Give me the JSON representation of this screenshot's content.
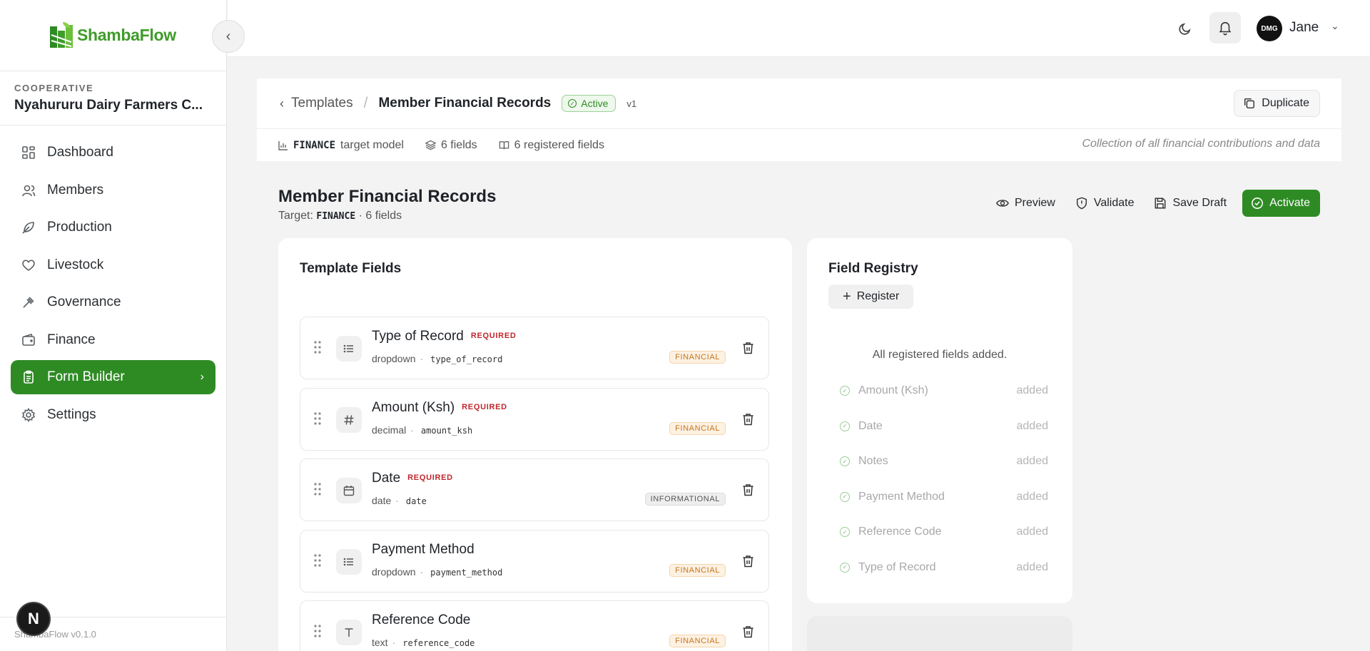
{
  "brand": {
    "name": "ShambaFlow",
    "version": "ShambaFlow v0.1.0"
  },
  "cooperative": {
    "label": "COOPERATIVE",
    "name": "Nyahururu Dairy Farmers C..."
  },
  "nav": [
    {
      "label": "Dashboard",
      "icon": "dashboard-icon"
    },
    {
      "label": "Members",
      "icon": "users-icon"
    },
    {
      "label": "Production",
      "icon": "leaf-icon"
    },
    {
      "label": "Livestock",
      "icon": "heart-icon"
    },
    {
      "label": "Governance",
      "icon": "gavel-icon"
    },
    {
      "label": "Finance",
      "icon": "wallet-icon"
    },
    {
      "label": "Form Builder",
      "icon": "clipboard-icon",
      "active": true
    },
    {
      "label": "Settings",
      "icon": "gear-icon"
    }
  ],
  "topbar": {
    "user": "Jane",
    "avatar_text": "DMG"
  },
  "header": {
    "crumb_parent": "Templates",
    "crumb_current": "Member Financial Records",
    "status": "Active",
    "version": "v1",
    "duplicate": "Duplicate",
    "target_model_code": "FINANCE",
    "target_model_text": "target model",
    "fields_count": "6 fields",
    "registered_count": "6 registered fields",
    "description": "Collection of all financial contributions and data"
  },
  "page": {
    "title": "Member Financial Records",
    "sub_prefix": "Target:",
    "sub_code": "FINANCE",
    "sub_suffix": "· 6 fields",
    "actions": {
      "preview": "Preview",
      "validate": "Validate",
      "save": "Save Draft",
      "activate": "Activate"
    }
  },
  "template_fields": {
    "title": "Template Fields",
    "required_label": "REQUIRED",
    "items": [
      {
        "name": "Type of Record",
        "required": true,
        "type": "dropdown",
        "key": "type_of_record",
        "tag": "FINANCIAL",
        "icon": "list-icon"
      },
      {
        "name": "Amount (Ksh)",
        "required": true,
        "type": "decimal",
        "key": "amount_ksh",
        "tag": "FINANCIAL",
        "icon": "hash-icon"
      },
      {
        "name": "Date",
        "required": true,
        "type": "date",
        "key": "date",
        "tag": "INFORMATIONAL",
        "icon": "calendar-icon"
      },
      {
        "name": "Payment Method",
        "required": false,
        "type": "dropdown",
        "key": "payment_method",
        "tag": "FINANCIAL",
        "icon": "list-icon"
      },
      {
        "name": "Reference Code",
        "required": false,
        "type": "text",
        "key": "reference_code",
        "tag": "FINANCIAL",
        "icon": "text-icon"
      }
    ]
  },
  "registry": {
    "title": "Field Registry",
    "register": "Register",
    "note": "All registered fields added.",
    "added_label": "added",
    "items": [
      "Amount (Ksh)",
      "Date",
      "Notes",
      "Payment Method",
      "Reference Code",
      "Type of Record"
    ]
  },
  "colors": {
    "brand_green": "#2e8b24",
    "logo_green": "#3f9c2a",
    "required_red": "#c0262d",
    "financial_orange": "#c4761e"
  }
}
